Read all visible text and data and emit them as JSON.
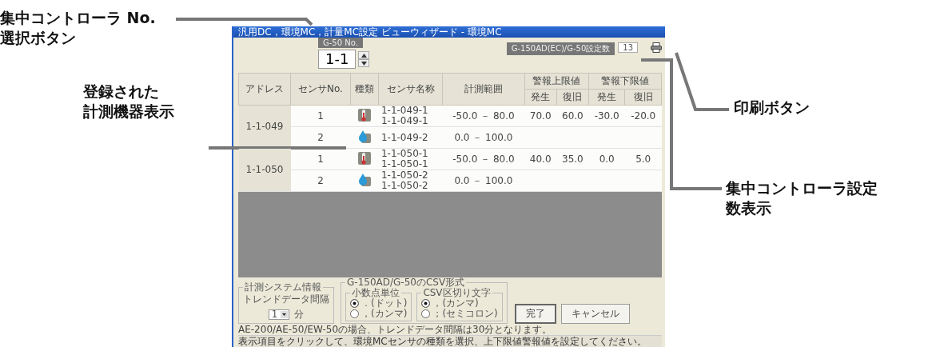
{
  "callouts_left": [
    {
      "lines": [
        "集中コントローラ No.",
        "選択ボタン"
      ]
    },
    {
      "lines": [
        "登録された",
        "計測機器表示"
      ]
    }
  ],
  "callouts_right": [
    {
      "lines": [
        "印刷ボタン"
      ]
    },
    {
      "lines": [
        "集中コントローラ設定",
        "数表示"
      ]
    }
  ],
  "window": {
    "title": "汎用DC，環境MC，計量MC設定 ビューウィザード - 環境MC"
  },
  "controller": {
    "label": "G-50 No.",
    "value": "1-1"
  },
  "setting_count": {
    "label": "G-150AD(EC)/G-50設定数",
    "value": "13"
  },
  "table": {
    "columns": [
      "アドレス",
      "センサNo.",
      "種類",
      "センサ名称",
      "計測範囲"
    ],
    "group_columns": [
      {
        "label": "警報上限値",
        "sub": [
          "発生",
          "復旧"
        ]
      },
      {
        "label": "警報下限値",
        "sub": [
          "発生",
          "復旧"
        ]
      }
    ],
    "groups": [
      {
        "address": "1-1-049",
        "sensors": [
          {
            "no": "1",
            "kind": "temperature",
            "names": [
              "1-1-049-1",
              "1-1-049-1"
            ],
            "range": "-50.0 － 80.0",
            "alarms": [
              "70.0",
              "60.0",
              "-30.0",
              "-20.0"
            ]
          },
          {
            "no": "2",
            "kind": "humidity",
            "names": [
              "1-1-049-2"
            ],
            "range": "0.0 － 100.0"
          }
        ]
      },
      {
        "address": "1-1-050",
        "sensors": [
          {
            "no": "1",
            "kind": "temperature",
            "names": [
              "1-1-050-1",
              "1-1-050-1"
            ],
            "range": "-50.0 － 80.0",
            "alarms": [
              "40.0",
              "35.0",
              "0.0",
              "5.0"
            ]
          },
          {
            "no": "2",
            "kind": "humidity",
            "names": [
              "1-1-050-2",
              "1-1-050-2"
            ],
            "range": "0.0 － 100.0"
          }
        ]
      }
    ]
  },
  "system_info": {
    "legend": "計測システム情報",
    "label": "トレンドデータ間隔",
    "value": "1",
    "unit": "分"
  },
  "csv_format": {
    "legend": "G-150AD/G-50のCSV形式",
    "groups": [
      {
        "legend": "小数点単位",
        "options": [
          {
            "label": "．(ドット)",
            "selected": true
          },
          {
            "label": "，(カンマ)",
            "selected": false
          }
        ]
      },
      {
        "legend": "CSV区切り文字",
        "options": [
          {
            "label": "，(カンマ)",
            "selected": true
          },
          {
            "label": "；(セミコロン)",
            "selected": false
          }
        ]
      }
    ]
  },
  "note": "AE-200/AE-50/EW-50の場合、トレンドデータ間隔は30分となります。",
  "buttons": [
    "完了",
    "キャンセル"
  ],
  "status_bar": "表示項目をクリックして、環境MCセンサの種類を選択、上下限値警報値を設定してください。"
}
